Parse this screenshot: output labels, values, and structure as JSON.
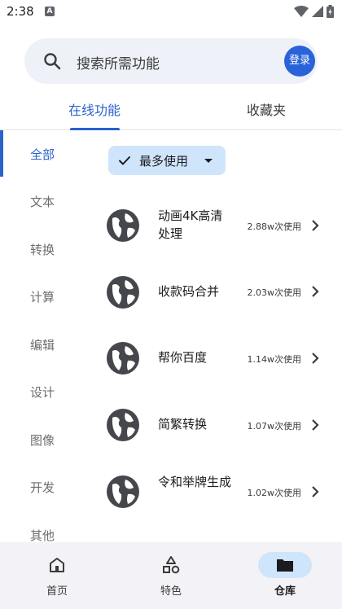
{
  "status": {
    "time": "2:38",
    "notification_letter": "A"
  },
  "search": {
    "placeholder": "搜索所需功能",
    "login_label": "登录"
  },
  "tabs": [
    {
      "label": "在线功能"
    },
    {
      "label": "收藏夹"
    }
  ],
  "sidebar": {
    "items": [
      {
        "label": "全部"
      },
      {
        "label": "文本"
      },
      {
        "label": "转换"
      },
      {
        "label": "计算"
      },
      {
        "label": "编辑"
      },
      {
        "label": "设计"
      },
      {
        "label": "图像"
      },
      {
        "label": "开发"
      },
      {
        "label": "其他"
      }
    ]
  },
  "filter": {
    "label": "最多使用"
  },
  "list": [
    {
      "title": "动画4K高清处理",
      "count": "2.88w次使用"
    },
    {
      "title": "收款码合并",
      "count": "2.03w次使用"
    },
    {
      "title": "帮你百度",
      "count": "1.14w次使用"
    },
    {
      "title": "简繁转换",
      "count": "1.07w次使用"
    },
    {
      "title": "令和举牌生成",
      "count": "1.02w次使用"
    }
  ],
  "bottom_nav": [
    {
      "label": "首页"
    },
    {
      "label": "特色"
    },
    {
      "label": "仓库"
    }
  ],
  "colors": {
    "accent": "#2b62c9",
    "login": "#2962d9",
    "chip": "#cfe5fb",
    "search_bg": "#eef1f7"
  }
}
